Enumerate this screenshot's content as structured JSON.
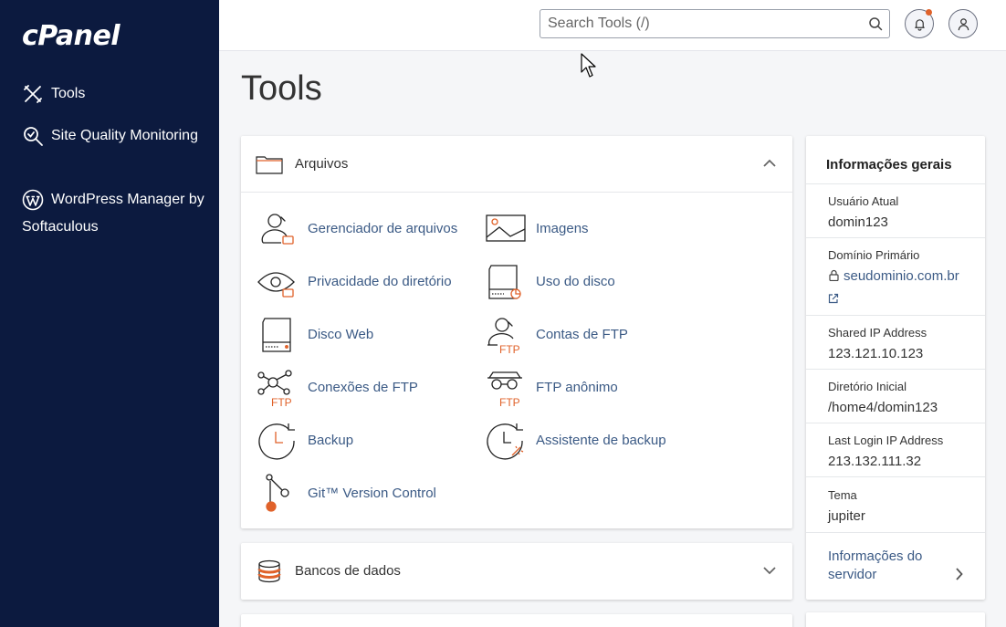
{
  "sidebar": {
    "logo": "cPanel",
    "items": [
      {
        "label": "Tools",
        "icon": "tools-icon"
      },
      {
        "label": "Site Quality Monitoring",
        "icon": "site-quality-icon"
      },
      {
        "label": "WordPress Manager by Softaculous",
        "icon": "wordpress-icon"
      }
    ]
  },
  "header": {
    "search_placeholder": "Search Tools (/)"
  },
  "page": {
    "title": "Tools"
  },
  "files_section": {
    "title": "Arquivos",
    "tools": [
      {
        "label": "Gerenciador de arquivos",
        "icon": "file-manager-icon"
      },
      {
        "label": "Imagens",
        "icon": "images-icon"
      },
      {
        "label": "Privacidade do diretório",
        "icon": "directory-privacy-icon"
      },
      {
        "label": "Uso do disco",
        "icon": "disk-usage-icon"
      },
      {
        "label": "Disco Web",
        "icon": "web-disk-icon"
      },
      {
        "label": "Contas de FTP",
        "icon": "ftp-accounts-icon"
      },
      {
        "label": "Conexões de FTP",
        "icon": "ftp-connections-icon"
      },
      {
        "label": "FTP anônimo",
        "icon": "anonymous-ftp-icon"
      },
      {
        "label": "Backup",
        "icon": "backup-icon"
      },
      {
        "label": "Assistente de backup",
        "icon": "backup-wizard-icon"
      },
      {
        "label": "Git™ Version Control",
        "icon": "git-icon"
      }
    ],
    "ftp_tag": "FTP"
  },
  "databases_section": {
    "title": "Bancos de dados"
  },
  "info": {
    "title": "Informações gerais",
    "current_user_label": "Usuário Atual",
    "current_user": "domin123",
    "primary_domain_label": "Domínio Primário",
    "primary_domain": "seudominio.com.br",
    "shared_ip_label": "Shared IP Address",
    "shared_ip": "123.121.10.123",
    "home_dir_label": "Diretório Inicial",
    "home_dir": "/home4/domin123",
    "last_login_label": "Last Login IP Address",
    "last_login": "213.132.111.32",
    "theme_label": "Tema",
    "theme": "jupiter",
    "server_info_link": "Informações do servidor"
  },
  "colors": {
    "sidebar_bg": "#0c1a3f",
    "accent_orange": "#e0622a",
    "link_blue": "#3b5a85"
  }
}
